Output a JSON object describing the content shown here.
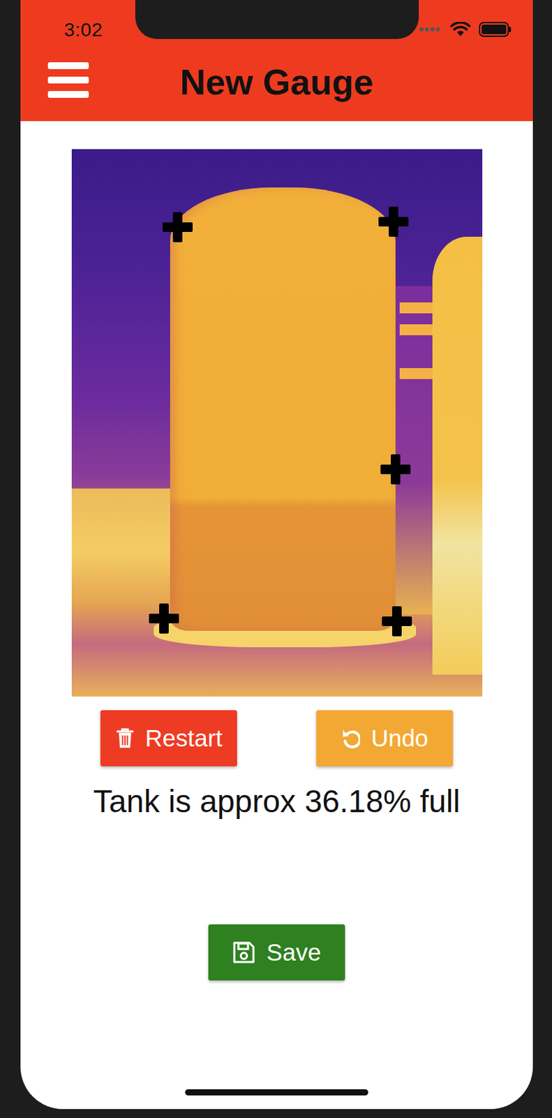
{
  "status_bar": {
    "time": "3:02"
  },
  "header": {
    "title": "New Gauge"
  },
  "buttons": [
    {
      "label": "Restart",
      "kind": "restart",
      "color": "#ee3b24"
    },
    {
      "label": "Undo",
      "kind": "undo",
      "color": "#f2a833"
    }
  ],
  "result": "Tank is approx 36.18% full",
  "save": {
    "label": "Save"
  }
}
